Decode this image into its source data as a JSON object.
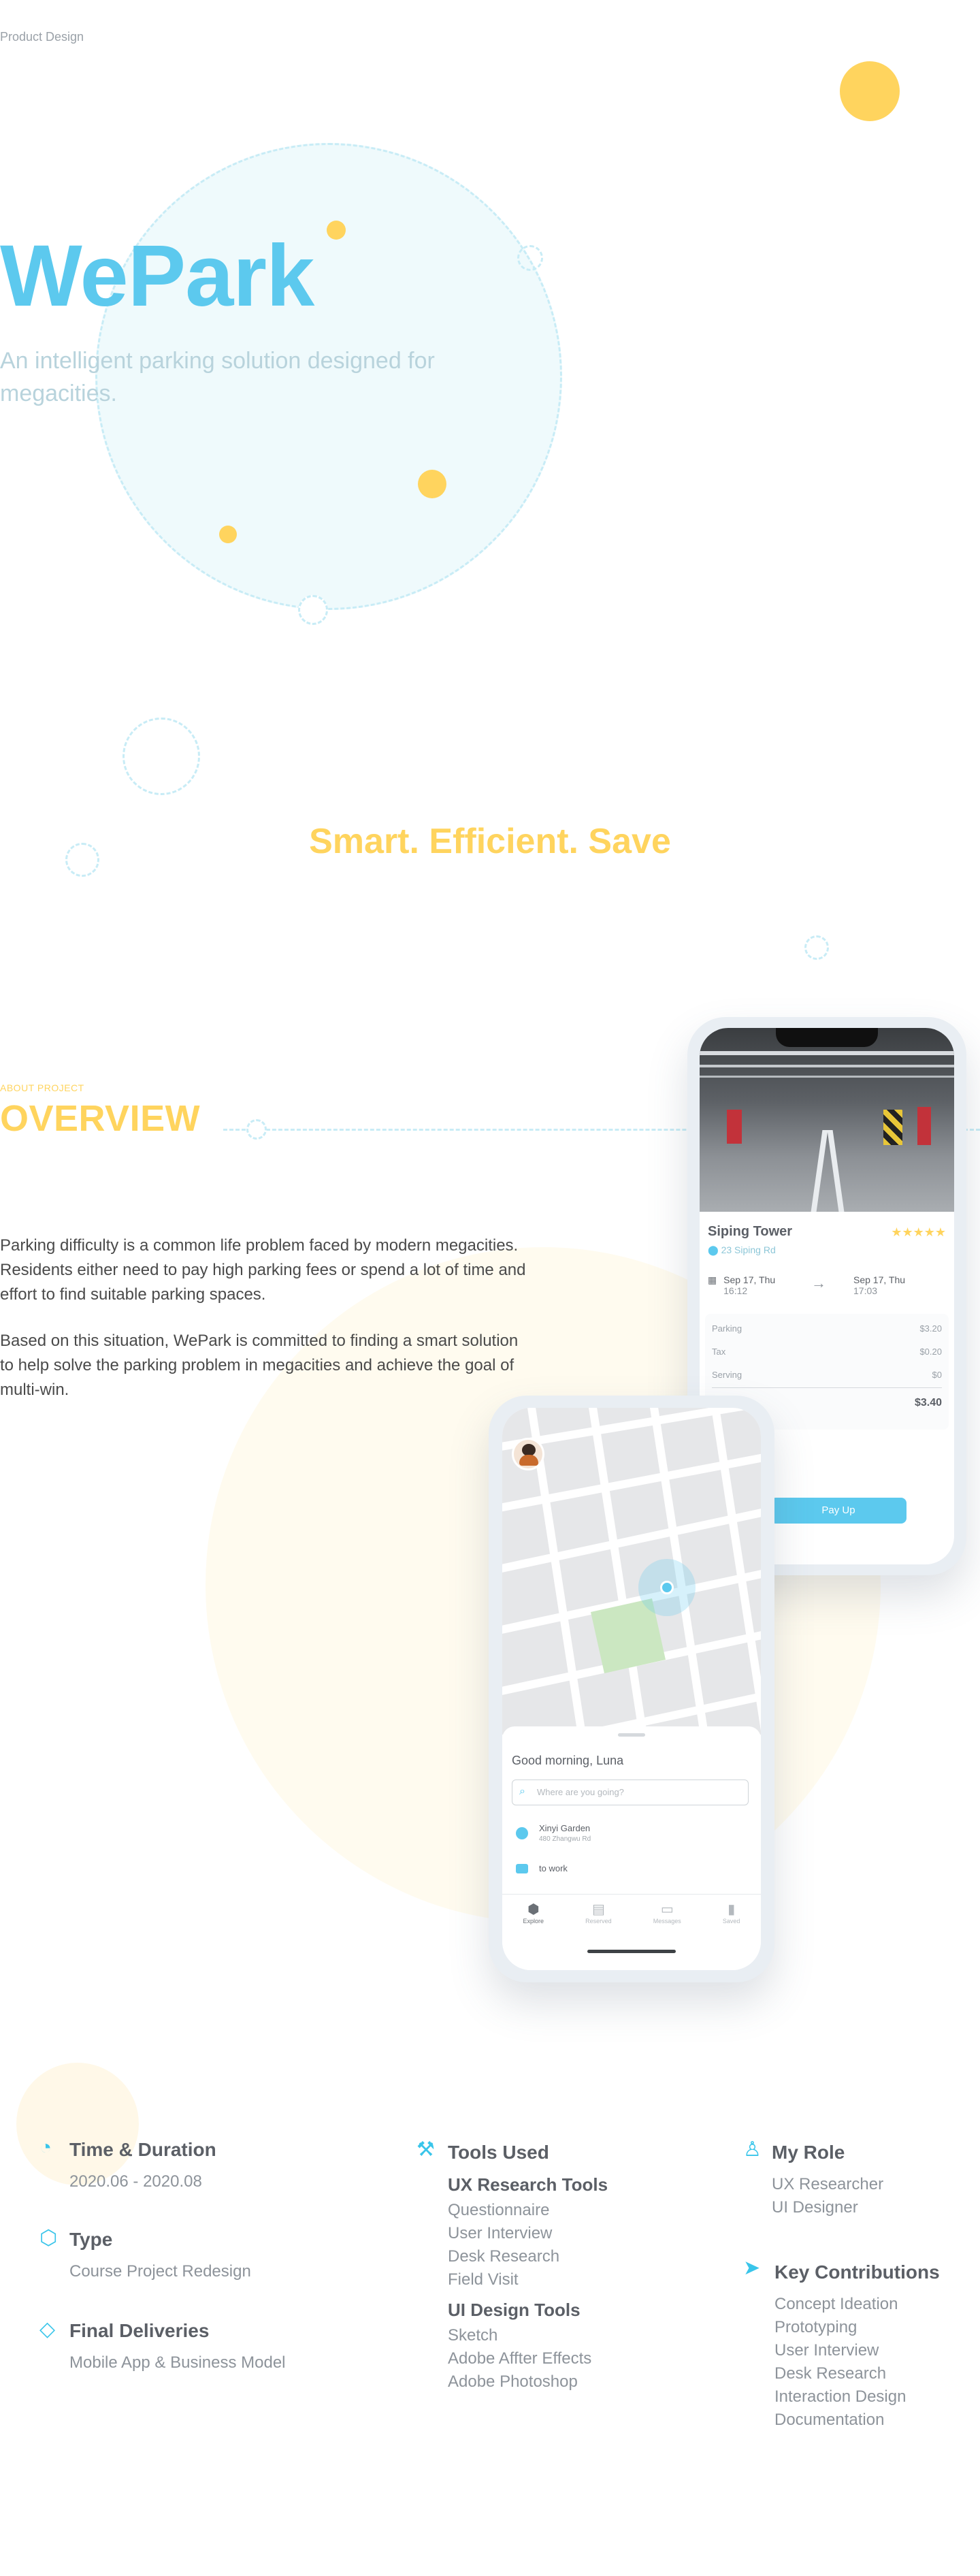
{
  "header": {
    "breadcrumb": "Product Design"
  },
  "hero": {
    "title": "WePark",
    "subtitle_line1": "An intelligent parking solution designed for",
    "subtitle_line2": "megacities."
  },
  "tagline": "Smart. Efficient. Save",
  "overview": {
    "eyebrow": "ABOUT PROJECT",
    "heading": "OVERVIEW",
    "paragraph1": [
      "Parking difficulty is a common life problem faced by modern megacities.",
      "Residents either need to pay high parking fees or spend a lot of time and",
      "effort to find suitable parking spaces."
    ],
    "paragraph2": [
      "Based on this situation, WePark is committed to finding a smart solution",
      "to help solve the parking problem in megacities and achieve the goal of",
      "multi-win."
    ]
  },
  "booking_screen": {
    "place_name": "Siping Tower",
    "rating": "★★★★★",
    "address": "23 Siping Rd",
    "start_date": "Sep 17, Thu",
    "start_time": "16:12",
    "end_date": "Sep 17, Thu",
    "end_time": "17:03",
    "fees": [
      {
        "label": "Parking",
        "value": "$3.20"
      },
      {
        "label": "Tax",
        "value": "$0.20"
      },
      {
        "label": "Serving",
        "value": "$0"
      }
    ],
    "total": "$3.40",
    "pay_button": "Pay Up"
  },
  "map_screen": {
    "greeting": "Good morning, Luna",
    "search_placeholder": "Where are you going?",
    "recent_place": "Xinyi Garden",
    "recent_address": "480 Zhangwu Rd",
    "shortcut": "to work",
    "tabs": [
      "Explore",
      "Reserved",
      "Messages",
      "Saved"
    ]
  },
  "details": {
    "time_duration": {
      "title": "Time & Duration",
      "value": "2020.06 - 2020.08"
    },
    "type": {
      "title": "Type",
      "value": "Course Project Redesign"
    },
    "deliveries": {
      "title": "Final Deliveries",
      "value": "Mobile App & Business Model"
    },
    "tools": {
      "title": "Tools Used",
      "ux_title": "UX Research Tools",
      "ux_items": [
        "Questionnaire",
        "User Interview",
        "Desk Research",
        "Field Visit"
      ],
      "ui_title": "UI Design Tools",
      "ui_items": [
        "Sketch",
        "Adobe Affter Effects",
        "Adobe Photoshop"
      ]
    },
    "role": {
      "title": "My Role",
      "items": [
        "UX Researcher",
        "UI Designer"
      ]
    },
    "contributions": {
      "title": "Key Contributions",
      "items": [
        "Concept Ideation",
        "Prototyping",
        "User Interview",
        "Desk Research",
        "Interaction Design",
        "Documentation"
      ]
    }
  },
  "colors": {
    "accent_blue": "#5cc9ee",
    "accent_yellow": "#ffd45e",
    "text_dark": "#4a4a4a",
    "text_muted": "#8d939a"
  }
}
